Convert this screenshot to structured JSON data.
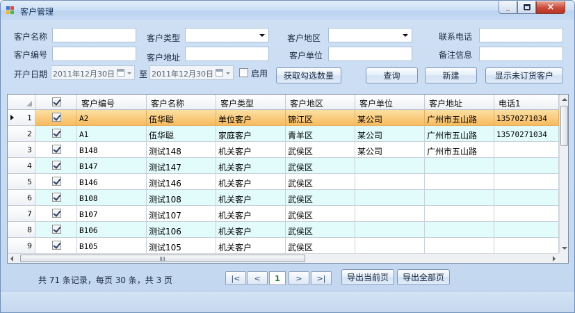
{
  "window": {
    "title": "客户管理",
    "controls": {
      "minimize": "minimize",
      "maximize": "maximize",
      "close": "×"
    }
  },
  "filters": {
    "customer_name_label": "客户名称",
    "customer_type_label": "客户类型",
    "customer_region_label": "客户地区",
    "phone_label": "联系电话",
    "customer_code_label": "客户编号",
    "customer_address_label": "客户地址",
    "customer_company_label": "客户单位",
    "remark_label": "备注信息",
    "open_date_label": "开户日期",
    "date_from": "2011年12月30日",
    "date_to_label": "至",
    "date_to": "2011年12月30日",
    "enable_label": "启用",
    "enable_checked": false
  },
  "buttons": {
    "get_checked_count": "获取勾选数量",
    "query": "查询",
    "new": "新建",
    "show_unordered": "显示未订货客户"
  },
  "grid": {
    "columns": [
      "客户编号",
      "客户名称",
      "客户类型",
      "客户地区",
      "客户单位",
      "客户地址",
      "电话1"
    ],
    "header_checked": true,
    "rows": [
      {
        "num": "1",
        "checked": true,
        "code": "A2",
        "name": "伍华聪",
        "type": "单位客户",
        "region": "锦江区",
        "company": "某公司",
        "address": "广州市五山路",
        "phone": "13570271034",
        "selected": true
      },
      {
        "num": "2",
        "checked": true,
        "code": "A1",
        "name": "伍华聪",
        "type": "家庭客户",
        "region": "青羊区",
        "company": "某公司",
        "address": "广州市五山路",
        "phone": "13570271034",
        "selected": false
      },
      {
        "num": "3",
        "checked": true,
        "code": "B148",
        "name": "测试148",
        "type": "机关客户",
        "region": "武侯区",
        "company": "某公司",
        "address": "广州市五山路",
        "phone": "",
        "selected": false
      },
      {
        "num": "4",
        "checked": true,
        "code": "B147",
        "name": "测试147",
        "type": "机关客户",
        "region": "武侯区",
        "company": "",
        "address": "",
        "phone": "",
        "selected": false
      },
      {
        "num": "5",
        "checked": true,
        "code": "B146",
        "name": "测试146",
        "type": "机关客户",
        "region": "武侯区",
        "company": "",
        "address": "",
        "phone": "",
        "selected": false
      },
      {
        "num": "6",
        "checked": true,
        "code": "B108",
        "name": "测试108",
        "type": "机关客户",
        "region": "武侯区",
        "company": "",
        "address": "",
        "phone": "",
        "selected": false
      },
      {
        "num": "7",
        "checked": true,
        "code": "B107",
        "name": "测试107",
        "type": "机关客户",
        "region": "武侯区",
        "company": "",
        "address": "",
        "phone": "",
        "selected": false
      },
      {
        "num": "8",
        "checked": true,
        "code": "B106",
        "name": "测试106",
        "type": "机关客户",
        "region": "武侯区",
        "company": "",
        "address": "",
        "phone": "",
        "selected": false
      },
      {
        "num": "9",
        "checked": true,
        "code": "B105",
        "name": "测试105",
        "type": "机关客户",
        "region": "武侯区",
        "company": "",
        "address": "",
        "phone": "",
        "selected": false
      }
    ]
  },
  "pager": {
    "summary": "共 71 条记录，每页 30 条，共 3 页",
    "first": "|<",
    "prev": "<",
    "current_page": "1",
    "next": ">",
    "last": ">|",
    "export_current": "导出当前页",
    "export_all": "导出全部页"
  },
  "colors": {
    "selected_row": "#f7bb5e",
    "alt_row": "#e2fbfb",
    "window_bg": "#c6d9f1"
  }
}
